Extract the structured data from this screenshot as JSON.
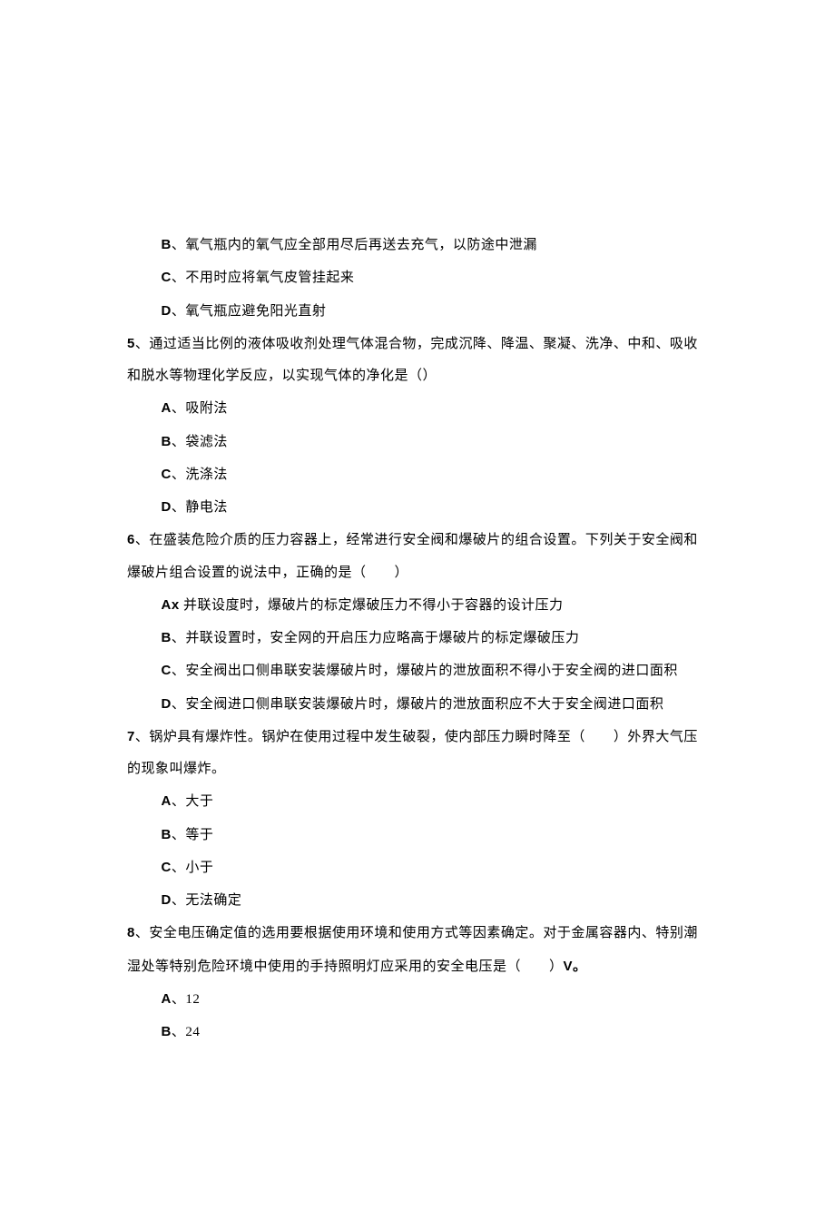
{
  "q4": {
    "optB": "B、氧气瓶内的氧气应全部用尽后再送去充气，以防途中泄漏",
    "optC": "C、不用时应将氧气皮管挂起来",
    "optD": "D、氧气瓶应避免阳光直射"
  },
  "q5": {
    "num": "5",
    "text": "、通过适当比例的液体吸收剂处理气体混合物，完成沉降、降温、聚凝、洗净、中和、吸收和脱水等物理化学反应，以实现气体的净化是（）",
    "optA": "A、吸附法",
    "optB": "B、袋滤法",
    "optC": "C、洗涤法",
    "optD": "D、静电法"
  },
  "q6": {
    "num": "6",
    "text": "、在盛装危险介质的压力容器上，经常进行安全阀和爆破片的组合设置。下列关于安全阀和爆破片组合设置的说法中，正确的是（　　）",
    "optA_prefix": "Ax",
    "optA_text": " 并联设度时，爆破片的标定爆破压力不得小于容器的设计压力",
    "optB": "B、并联设置时，安全网的开启压力应略高于爆破片的标定爆破压力",
    "optC": "C、安全阀出口侧串联安装爆破片时，爆破片的泄放面积不得小于安全阀的进口面积",
    "optD": "D、安全阀进口侧串联安装爆破片时，爆破片的泄放面积应不大于安全阀进口面积"
  },
  "q7": {
    "num": "7",
    "text": "、锅炉具有爆炸性。锅炉在使用过程中发生破裂，使内部压力瞬时降至（　　）外界大气压的现象叫爆炸。",
    "optA": "A、大于",
    "optB": "B、等于",
    "optC": "C、小于",
    "optD": "D、无法确定"
  },
  "q8": {
    "num": "8",
    "text_part1": "、安全电压确定值的选用要根据使用环境和使用方式等因素确定。对于金属容器内、特别潮湿处等特别危险环境中使用的手持照明灯应采用的安全电压是（　　）",
    "text_part2": "V。",
    "optA": "A、12",
    "optB": "B、24"
  }
}
